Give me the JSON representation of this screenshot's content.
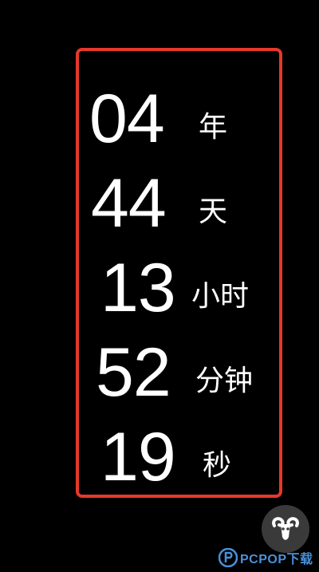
{
  "countdown": {
    "years": {
      "value": "04",
      "unit": "年"
    },
    "days": {
      "value": "44",
      "unit": "天"
    },
    "hours": {
      "value": "13",
      "unit": "小时"
    },
    "minutes": {
      "value": "52",
      "unit": "分钟"
    },
    "seconds": {
      "value": "19",
      "unit": "秒"
    }
  },
  "colors": {
    "background": "#000000",
    "text": "#ffffff",
    "highlight_border": "#e5392a",
    "fab_background": "#3a3a3a",
    "watermark": "#4a90d9"
  },
  "fab": {
    "icon": "ram-head-icon"
  },
  "watermark": {
    "brand": "PCPOP",
    "brand_suffix": "下载",
    "logo_icon": "p-logo-icon"
  }
}
